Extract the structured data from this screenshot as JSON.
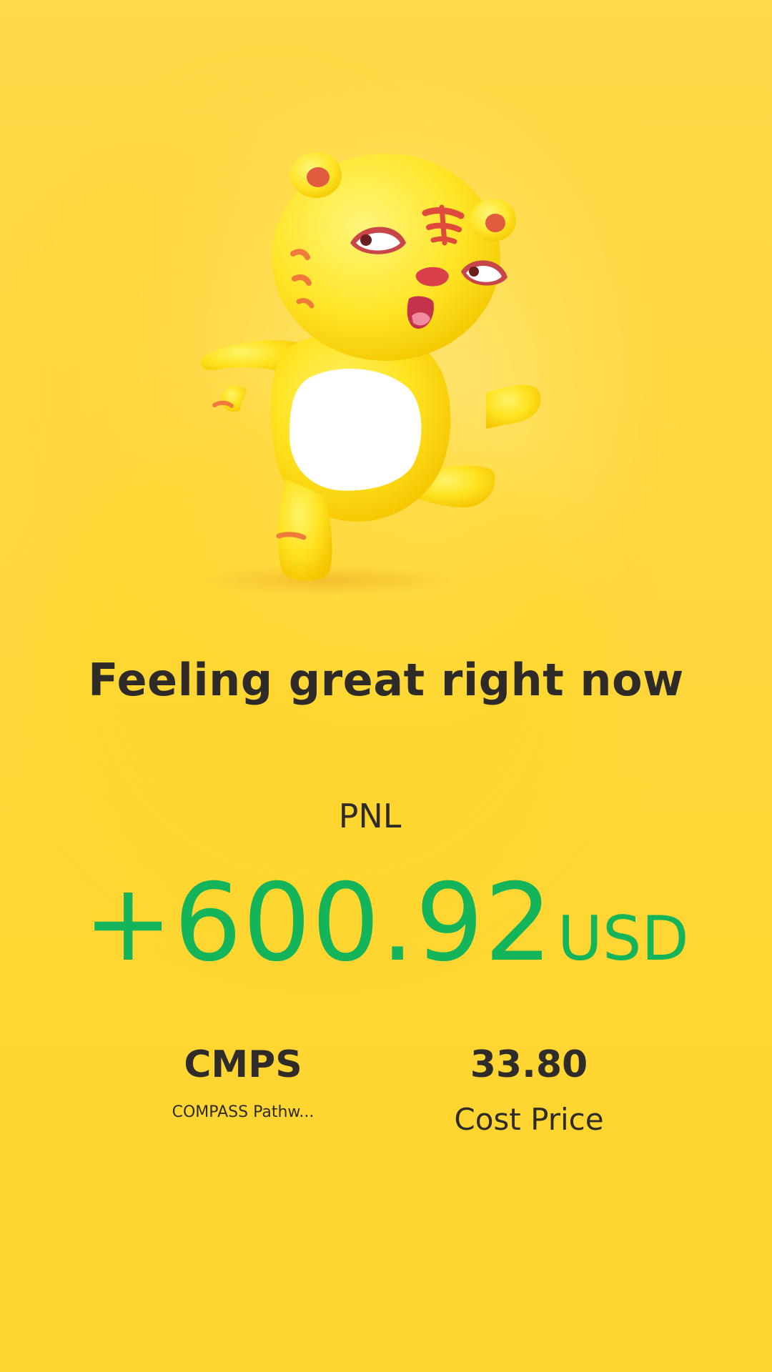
{
  "headline": "Feeling great right now",
  "pnl": {
    "label": "PNL",
    "value": "+600.92",
    "unit": "USD"
  },
  "stock": {
    "symbol": "CMPS",
    "name": "COMPASS Pathw..."
  },
  "cost": {
    "value": "33.80",
    "label": "Cost Price"
  },
  "colors": {
    "background": "#FFD634",
    "gain_green": "#14B45A",
    "text_dark": "#2E2B29"
  },
  "icons": {
    "mascot": "tiger-mascot-icon"
  }
}
